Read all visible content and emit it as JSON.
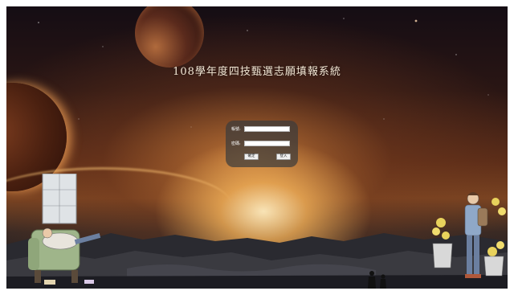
{
  "page": {
    "title": "108學年度四技甄選志願填報系統"
  },
  "login": {
    "account_label": "帳號:",
    "password_label": "密碼:",
    "account_value": "",
    "password_value": "",
    "confirm_button": "確定",
    "enter_button": "登入"
  },
  "colors": {
    "panel": "#3c3c3c",
    "title_text": "#f4e8d6",
    "field_bg": "#ffffff"
  },
  "icons": {
    "illustration_left": "person-reading-in-chair-illustration",
    "illustration_right": "person-with-backpack-and-flowers-illustration",
    "silhouettes": "two-people-silhouette"
  }
}
